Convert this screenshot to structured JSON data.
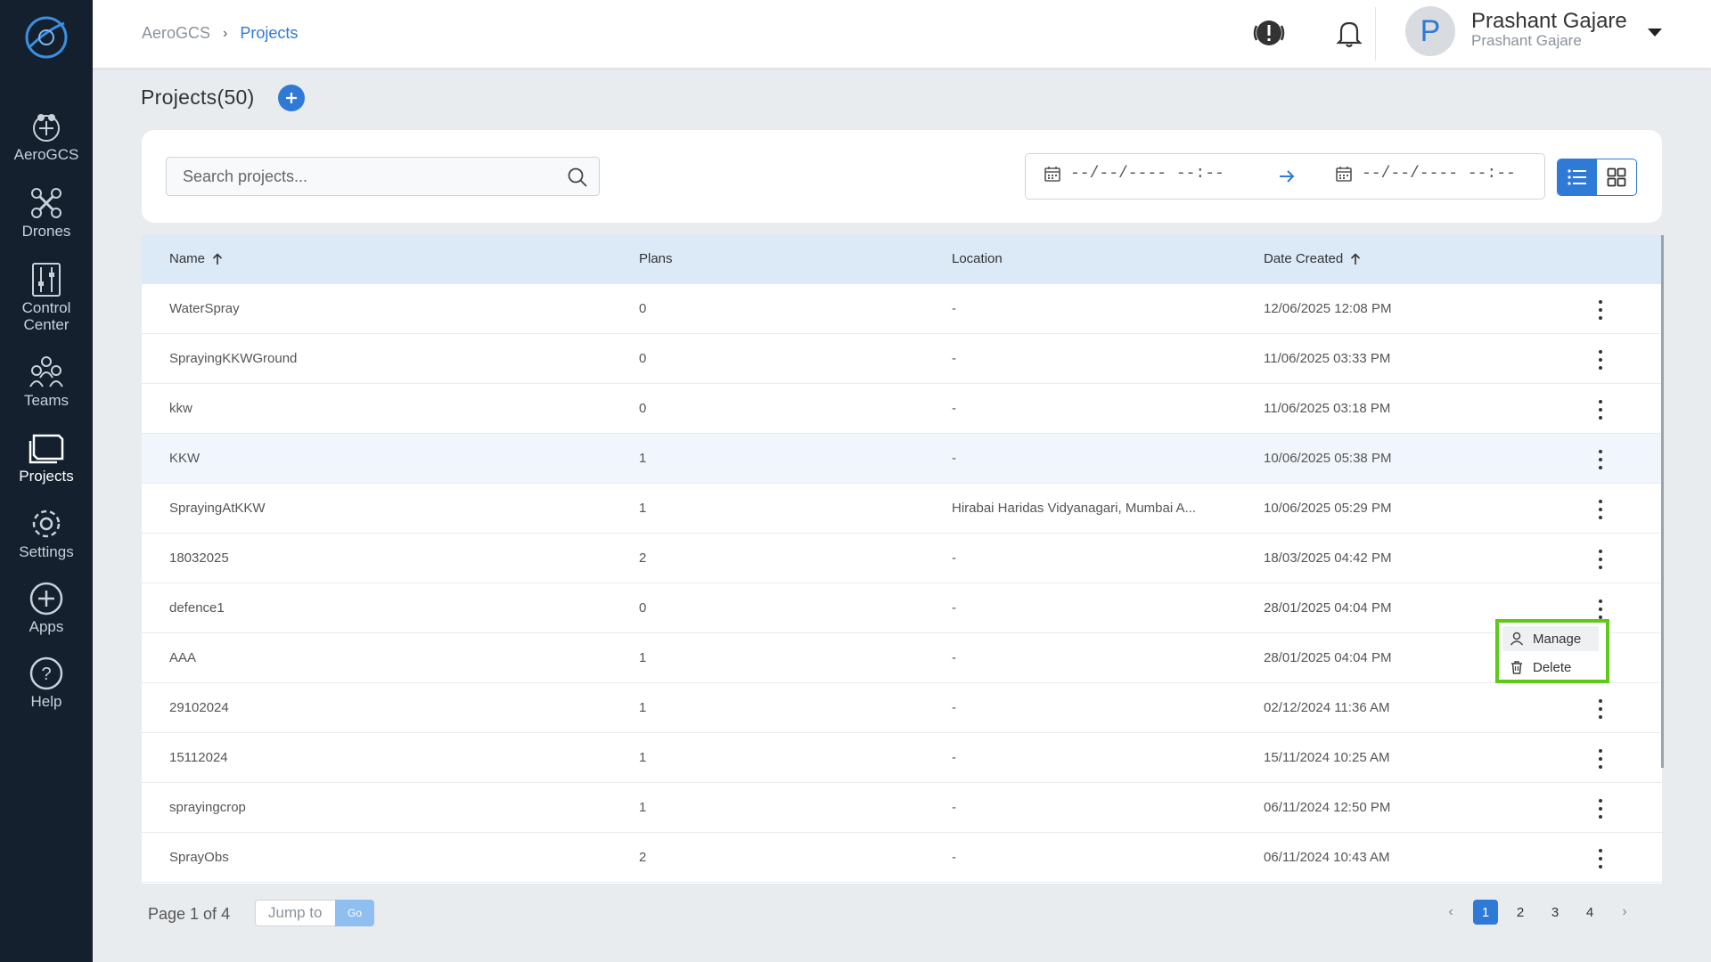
{
  "sidebar": {
    "items": [
      {
        "label": "AeroGCS",
        "icon": "drone-radar-icon"
      },
      {
        "label": "Drones",
        "icon": "drone-icon"
      },
      {
        "label": "Control\nCenter",
        "icon": "sliders-icon"
      },
      {
        "label": "Teams",
        "icon": "team-icon"
      },
      {
        "label": "Projects",
        "icon": "folder-icon"
      },
      {
        "label": "Settings",
        "icon": "gear-icon"
      },
      {
        "label": "Apps",
        "icon": "plus-circle-icon"
      },
      {
        "label": "Help",
        "icon": "help-icon"
      }
    ],
    "active": "Projects"
  },
  "header": {
    "breadcrumb_root": "AeroGCS",
    "breadcrumb_current": "Projects",
    "user_name": "Prashant Gajare",
    "user_subtitle": "Prashant Gajare",
    "avatar_initial": "P"
  },
  "page": {
    "title": "Projects(50)"
  },
  "filters": {
    "search_placeholder": "Search projects...",
    "date_from": "--/--/---- --:--",
    "date_to": "--/--/---- --:--"
  },
  "table": {
    "columns": {
      "name": "Name",
      "plans": "Plans",
      "location": "Location",
      "date_created": "Date Created"
    },
    "rows": [
      {
        "name": "WaterSpray",
        "plans": "0",
        "location": "-",
        "date": "12/06/2025 12:08 PM"
      },
      {
        "name": "SprayingKKWGround",
        "plans": "0",
        "location": "-",
        "date": "11/06/2025 03:33 PM"
      },
      {
        "name": "kkw",
        "plans": "0",
        "location": "-",
        "date": "11/06/2025 03:18 PM"
      },
      {
        "name": "KKW",
        "plans": "1",
        "location": "-",
        "date": "10/06/2025 05:38 PM"
      },
      {
        "name": "SprayingAtKKW",
        "plans": "1",
        "location": "Hirabai Haridas Vidyanagari, Mumbai A...",
        "date": "10/06/2025 05:29 PM"
      },
      {
        "name": "18032025",
        "plans": "2",
        "location": "-",
        "date": "18/03/2025 04:42 PM"
      },
      {
        "name": "defence1",
        "plans": "0",
        "location": "-",
        "date": "28/01/2025 04:04 PM"
      },
      {
        "name": "AAA",
        "plans": "1",
        "location": "-",
        "date": "28/01/2025 04:04 PM"
      },
      {
        "name": "29102024",
        "plans": "1",
        "location": "-",
        "date": "02/12/2024 11:36 AM"
      },
      {
        "name": "15112024",
        "plans": "1",
        "location": "-",
        "date": "15/11/2024 10:25 AM"
      },
      {
        "name": "sprayingcrop",
        "plans": "1",
        "location": "-",
        "date": "06/11/2024 12:50 PM"
      },
      {
        "name": "SprayObs",
        "plans": "2",
        "location": "-",
        "date": "06/11/2024 10:43 AM"
      }
    ]
  },
  "context_menu": {
    "manage": "Manage",
    "delete": "Delete"
  },
  "pagination": {
    "info": "Page 1 of 4",
    "jump_placeholder": "Jump to",
    "go_label": "Go",
    "pages": [
      "1",
      "2",
      "3",
      "4"
    ],
    "prev": "‹",
    "next": "›"
  },
  "colors": {
    "sidebar_bg": "#14202e",
    "accent": "#2f7ad6",
    "menu_highlight": "#5fc91a"
  }
}
